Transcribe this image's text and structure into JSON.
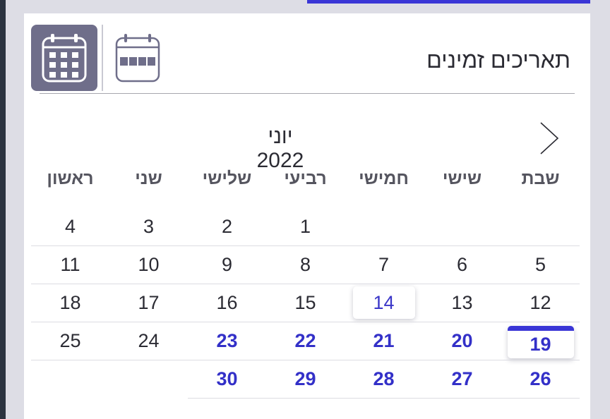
{
  "header": {
    "title": "תאריכים זמינים",
    "views": [
      {
        "name": "month-view",
        "icon": "calendar-month-icon",
        "active": true
      },
      {
        "name": "week-view",
        "icon": "calendar-week-icon",
        "active": false
      }
    ]
  },
  "calendar": {
    "month_label": "יוני 2022",
    "next_icon": "chevron-right-icon",
    "weekdays": [
      "ראשון",
      "שני",
      "שלישי",
      "רביעי",
      "חמישי",
      "שישי",
      "שבת"
    ],
    "weeks": [
      [
        "",
        "",
        "",
        "1",
        "2",
        "3",
        "4"
      ],
      [
        "5",
        "6",
        "7",
        "8",
        "9",
        "10",
        "11"
      ],
      [
        "12",
        "13",
        "14",
        "15",
        "16",
        "17",
        "18"
      ],
      [
        "19",
        "20",
        "21",
        "22",
        "23",
        "24",
        "25"
      ],
      [
        "26",
        "27",
        "28",
        "29",
        "30",
        "",
        ""
      ]
    ],
    "today": "14",
    "selected": "19",
    "available": [
      "19",
      "20",
      "21",
      "22",
      "23",
      "26",
      "27",
      "28",
      "29",
      "30"
    ]
  },
  "colors": {
    "accent": "#3a36d6",
    "available_text": "#3330c8",
    "active_view_bg": "#6f6e8a"
  }
}
